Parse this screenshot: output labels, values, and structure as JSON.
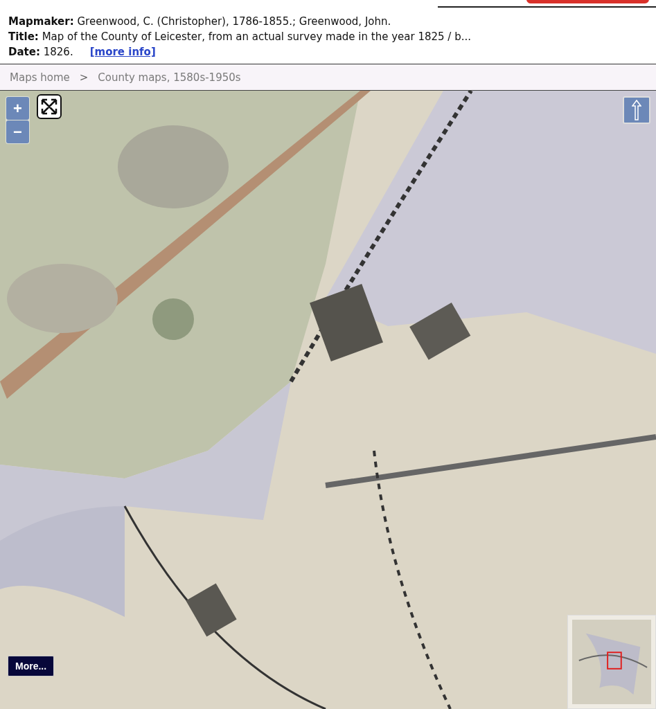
{
  "record": {
    "mapmaker_label": "Mapmaker:",
    "mapmaker": "Greenwood, C. (Christopher), 1786-1855.; Greenwood, John.",
    "title_label": "Title:",
    "title": "Map of the County of Leicester, from an actual survey made in the year 1825 / b...",
    "date_label": "Date:",
    "date": "1826.",
    "more_info": "[more info]"
  },
  "breadcrumb": [
    {
      "label": "Maps home",
      "kind": "link"
    },
    {
      "label": ">",
      "kind": "separator"
    },
    {
      "label": "County maps, 1580s-1950s",
      "kind": "link"
    }
  ],
  "map": {
    "kind": "picture",
    "zoom_in": "+",
    "zoom_out": "−",
    "more_button": "More..."
  }
}
